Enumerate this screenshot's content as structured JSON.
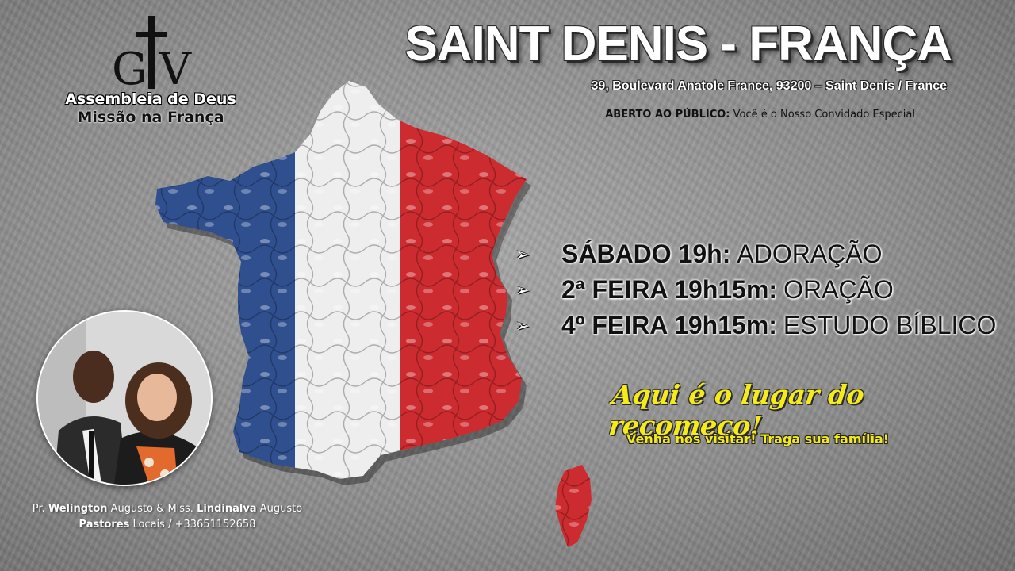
{
  "logo": {
    "monogram": "G V",
    "org_line1": "Assembleia de Deus",
    "org_line2": "Missão na França"
  },
  "header": {
    "title": "SAINT DENIS - FRANÇA",
    "address": "39, Boulevard Anatole France, 93200 – Saint Denis / France",
    "open_label": "ABERTO AO PÚBLICO:",
    "open_text": "Você é o Nosso Convidado Especial"
  },
  "schedule": [
    {
      "day": "SÁBADO 19h:",
      "activity": "ADORAÇÃO"
    },
    {
      "day": "2ª FEIRA 19h15m:",
      "activity": "ORAÇÃO"
    },
    {
      "day": "4º FEIRA 19h15m:",
      "activity": "ESTUDO BÍBLICO"
    }
  ],
  "tagline": "Aqui é o lugar do recomeço!",
  "invite": "Venha nos visitar! Traga sua família!",
  "pastors": {
    "p1_prefix": "Pr.",
    "p1_first": "Welington",
    "p1_last": "Augusto",
    "amp": "&",
    "p2_prefix": "Miss.",
    "p2_first": "Lindinalva",
    "p2_last": "Augusto",
    "role_bold": "Pastores",
    "role_rest": "Locais",
    "phone": "/ +33651152658"
  },
  "colors": {
    "flag_blue": "#2f4f8f",
    "flag_white": "#eeeeee",
    "flag_red": "#cc2b2f",
    "accent_yellow": "#f5ea1a"
  }
}
